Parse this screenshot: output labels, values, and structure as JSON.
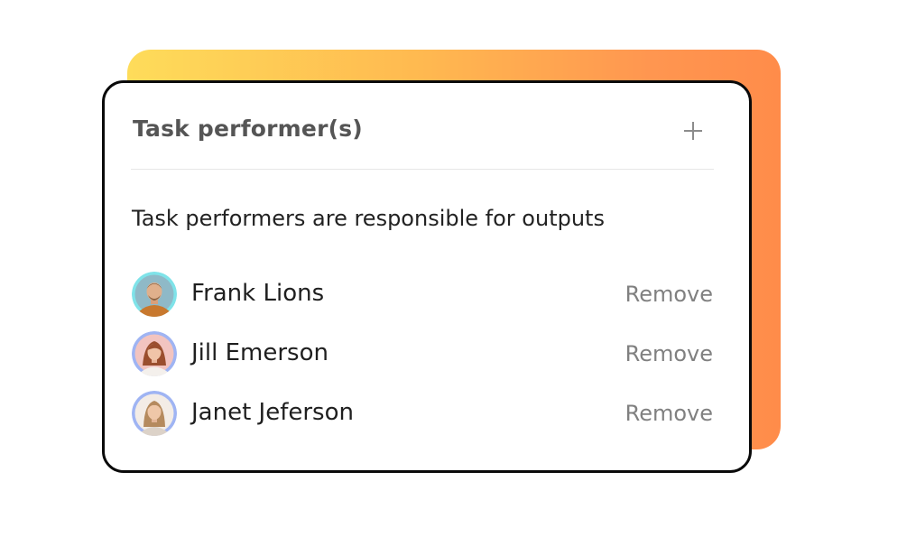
{
  "card": {
    "title": "Task performer(s)",
    "add_icon": "plus-icon",
    "description": "Task performers are responsible for outputs"
  },
  "performers": [
    {
      "name": "Frank Lions",
      "remove_label": "Remove",
      "ring_color": "#7fe3e9"
    },
    {
      "name": "Jill Emerson",
      "remove_label": "Remove",
      "ring_color": "#9fb4f3"
    },
    {
      "name": "Janet Jeferson",
      "remove_label": "Remove",
      "ring_color": "#9fb4f3"
    }
  ],
  "colors": {
    "gradient_start": "#fedc5a",
    "gradient_end": "#ff8c4a",
    "card_border": "#0a0a0a",
    "title_text": "#555555",
    "remove_text": "#808080"
  }
}
